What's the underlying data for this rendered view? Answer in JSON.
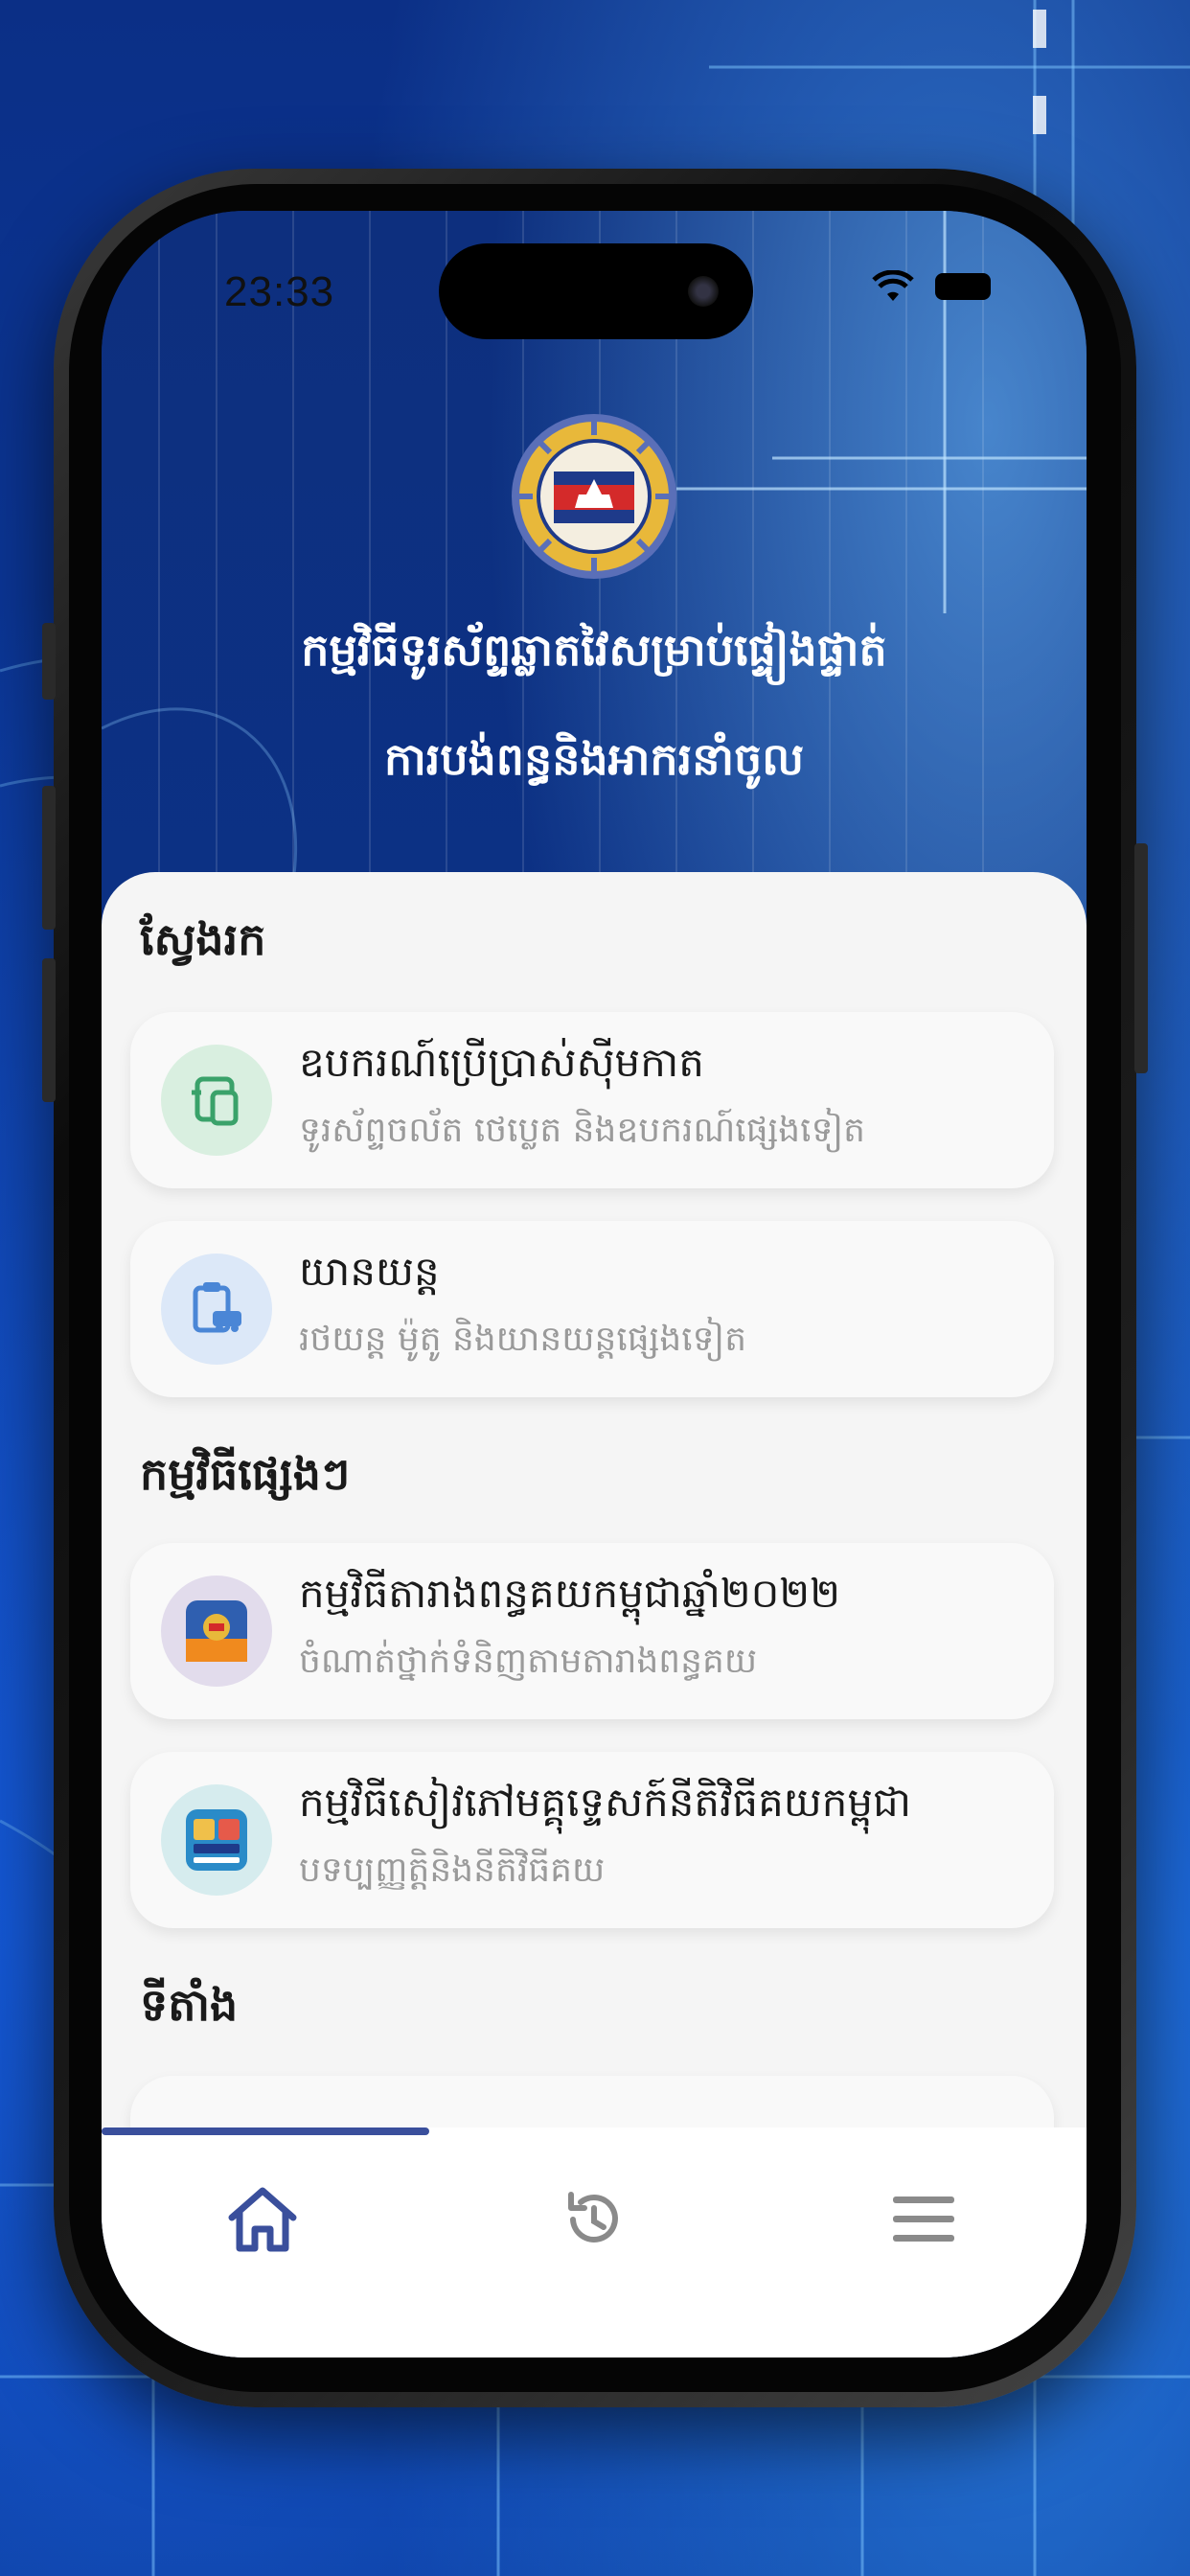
{
  "status_bar": {
    "time": "23:33"
  },
  "header": {
    "title_line1": "កម្មវិធីទូរស័ព្ទឆ្លាតវៃសម្រាប់ផ្ទៀងផ្ទាត់",
    "title_line2": "ការបង់ពន្ធនិងអាករនាំចូល"
  },
  "sections": {
    "search": {
      "title": "ស្វែងរក",
      "items": [
        {
          "title": "ឧបករណ៍ប្រើប្រាស់ស៊ីមកាត",
          "subtitle": "ទូរស័ព្ទចល័ត ថេប្លេត និងឧបករណ៍ផ្សេងទៀត",
          "icon": "devices-icon"
        },
        {
          "title": "យានយន្ត",
          "subtitle": "រថយន្ត ម៉ូតូ និងយានយន្តផ្សេងទៀត",
          "icon": "vehicle-clipboard-icon"
        }
      ]
    },
    "other_apps": {
      "title": "កម្មវិធីផ្សេងៗ",
      "items": [
        {
          "title": "កម្មវិធីតារាងពន្ធគយកម្ពុជាឆ្នាំ២០២២",
          "subtitle": "ចំណាត់ថ្នាក់ទំនិញតាមតារាងពន្ធគយ",
          "icon": "tariff-app-icon"
        },
        {
          "title": "កម្មវិធីសៀវភៅមគ្គុទ្ទេសក៍នីតិវិធីគយកម្ពុជា",
          "subtitle": "បទប្បញ្ញត្តិនិងនីតិវិធីគយ",
          "icon": "procedures-app-icon"
        }
      ]
    },
    "location": {
      "title": "ទីតាំង"
    }
  },
  "tabbar": {
    "tabs": [
      {
        "name": "home",
        "icon": "home-icon",
        "active": true
      },
      {
        "name": "history",
        "icon": "history-icon",
        "active": false
      },
      {
        "name": "menu",
        "icon": "menu-icon",
        "active": false
      }
    ],
    "accent": "#3a4f9c",
    "inactive": "#8a8a8a"
  }
}
